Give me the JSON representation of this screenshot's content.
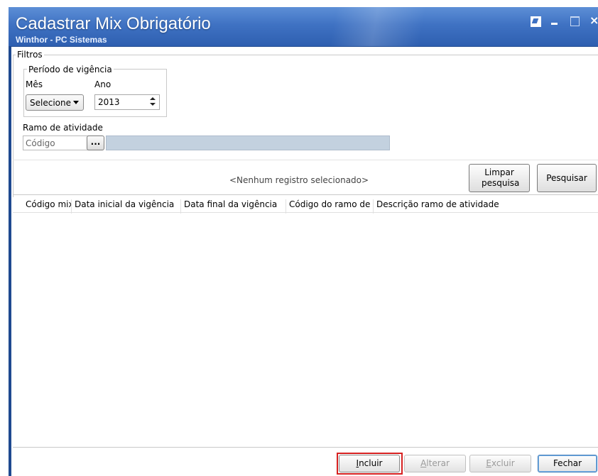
{
  "window": {
    "title": "Cadastrar Mix Obrigatório",
    "subtitle": "Winthor - PC Sistemas"
  },
  "filters": {
    "group_label": "Filtros",
    "period": {
      "group_label": "Período de vigência",
      "month_label": "Mês",
      "month_value": "Selecione",
      "year_label": "Ano",
      "year_value": "2013"
    },
    "activity": {
      "label": "Ramo de atividade",
      "code_placeholder": "Código",
      "lookup_label": "...",
      "description_value": ""
    },
    "clear_button": "Limpar pesquisa",
    "search_button": "Pesquisar"
  },
  "grid": {
    "columns": [
      "Código mix",
      "Data inicial da vigência",
      "Data final da vigência",
      "Código do ramo de at",
      "Descrição ramo de atividade"
    ],
    "empty_message": "<Nenhum registro selecionado>"
  },
  "footer": {
    "include": {
      "first": "I",
      "rest": "ncluir"
    },
    "alter": {
      "first": "A",
      "rest": "lterar"
    },
    "delete": {
      "first": "E",
      "rest": "xcluir"
    },
    "close": "Fechar"
  },
  "colors": {
    "titlebar": "#3f72c3",
    "highlight": "#d62020",
    "description_field": "#c3d1df"
  }
}
